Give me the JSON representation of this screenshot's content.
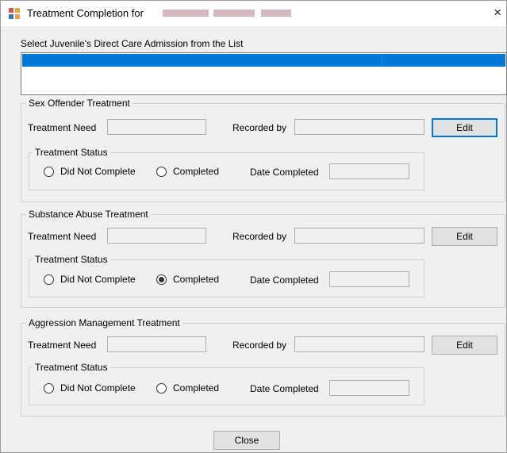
{
  "window": {
    "title": "Treatment Completion for",
    "close_glyph": "×"
  },
  "list": {
    "label": "Select Juvenile's Direct Care Admission from the List"
  },
  "sections": [
    {
      "title": "Sex Offender Treatment",
      "treatment_need_label": "Treatment Need",
      "recorded_by_label": "Recorded by",
      "edit_label": "Edit",
      "status_title": "Treatment Status",
      "did_not_complete_label": "Did Not Complete",
      "completed_label": "Completed",
      "date_completed_label": "Date Completed",
      "selected": "none"
    },
    {
      "title": "Substance Abuse Treatment",
      "treatment_need_label": "Treatment Need",
      "recorded_by_label": "Recorded by",
      "edit_label": "Edit",
      "status_title": "Treatment Status",
      "did_not_complete_label": "Did Not Complete",
      "completed_label": "Completed",
      "date_completed_label": "Date Completed",
      "selected": "completed"
    },
    {
      "title": "Aggression Management Treatment",
      "treatment_need_label": "Treatment Need",
      "recorded_by_label": "Recorded by",
      "edit_label": "Edit",
      "status_title": "Treatment Status",
      "did_not_complete_label": "Did Not Complete",
      "completed_label": "Completed",
      "date_completed_label": "Date Completed",
      "selected": "none"
    }
  ],
  "footer": {
    "close_label": "Close"
  }
}
